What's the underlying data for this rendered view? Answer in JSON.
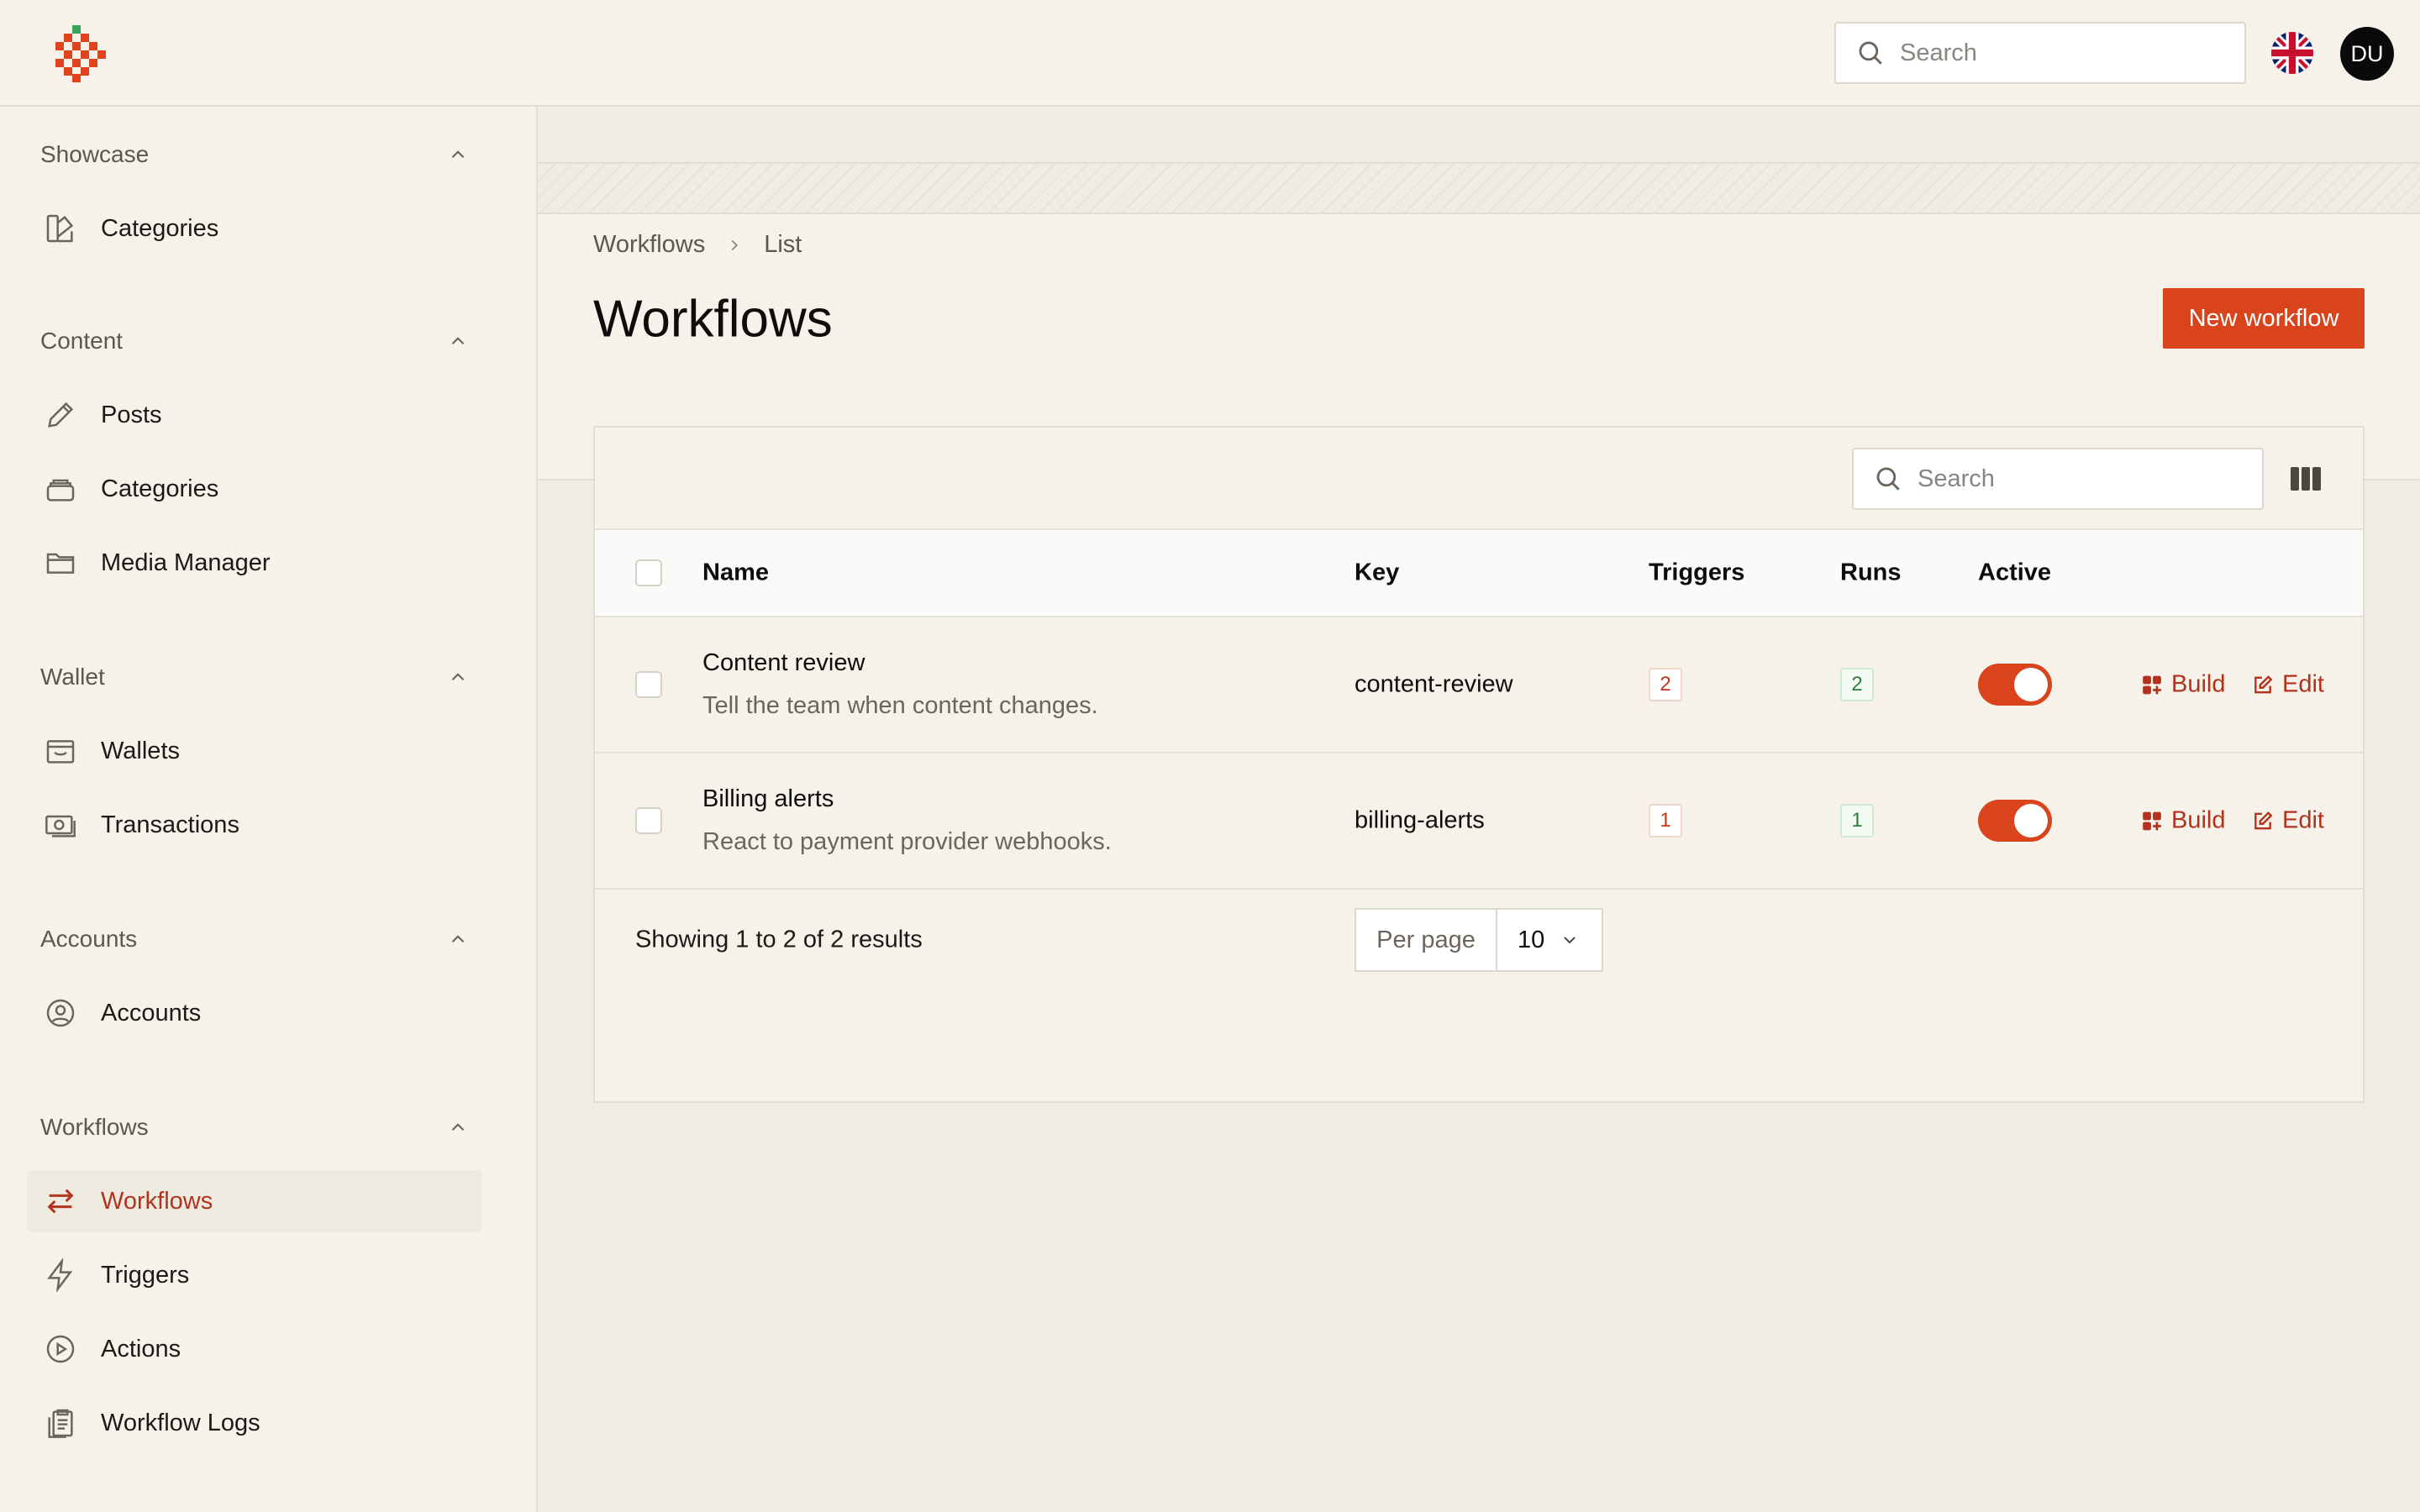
{
  "topbar": {
    "search_placeholder": "Search",
    "avatar_initials": "DU"
  },
  "sidebar": {
    "groups": [
      {
        "label": "Showcase",
        "items": [
          {
            "label": "Categories",
            "icon": "categories-showcase-icon"
          }
        ]
      },
      {
        "label": "Content",
        "items": [
          {
            "label": "Posts",
            "icon": "pencil-icon"
          },
          {
            "label": "Categories",
            "icon": "stack-icon"
          },
          {
            "label": "Media Manager",
            "icon": "folder-icon"
          }
        ]
      },
      {
        "label": "Wallet",
        "items": [
          {
            "label": "Wallets",
            "icon": "wallet-icon"
          },
          {
            "label": "Transactions",
            "icon": "cash-icon"
          }
        ]
      },
      {
        "label": "Accounts",
        "items": [
          {
            "label": "Accounts",
            "icon": "user-circle-icon"
          }
        ]
      },
      {
        "label": "Workflows",
        "items": [
          {
            "label": "Workflows",
            "icon": "arrows-exchange-icon",
            "active": true
          },
          {
            "label": "Triggers",
            "icon": "bolt-icon"
          },
          {
            "label": "Actions",
            "icon": "play-circle-icon"
          },
          {
            "label": "Workflow Logs",
            "icon": "clipboard-icon"
          }
        ]
      }
    ]
  },
  "page": {
    "breadcrumb": [
      "Workflows",
      "List"
    ],
    "title": "Workflows",
    "new_button": "New workflow"
  },
  "table": {
    "search_placeholder": "Search",
    "columns": {
      "name": "Name",
      "key": "Key",
      "triggers": "Triggers",
      "runs": "Runs",
      "active": "Active"
    },
    "rows": [
      {
        "name": "Content review",
        "description": "Tell the team when content changes.",
        "key": "content-review",
        "triggers": "2",
        "runs": "2",
        "active": true,
        "build_label": "Build",
        "edit_label": "Edit"
      },
      {
        "name": "Billing alerts",
        "description": "React to payment provider webhooks.",
        "key": "billing-alerts",
        "triggers": "1",
        "runs": "1",
        "active": true,
        "build_label": "Build",
        "edit_label": "Edit"
      }
    ],
    "showing": "Showing 1 to 2 of 2 results",
    "per_page_label": "Per page",
    "per_page_value": "10"
  },
  "colors": {
    "accent": "#d9441d",
    "accent_text": "#b2331d",
    "background": "#f0ece2",
    "panel": "#f6f2ea"
  }
}
